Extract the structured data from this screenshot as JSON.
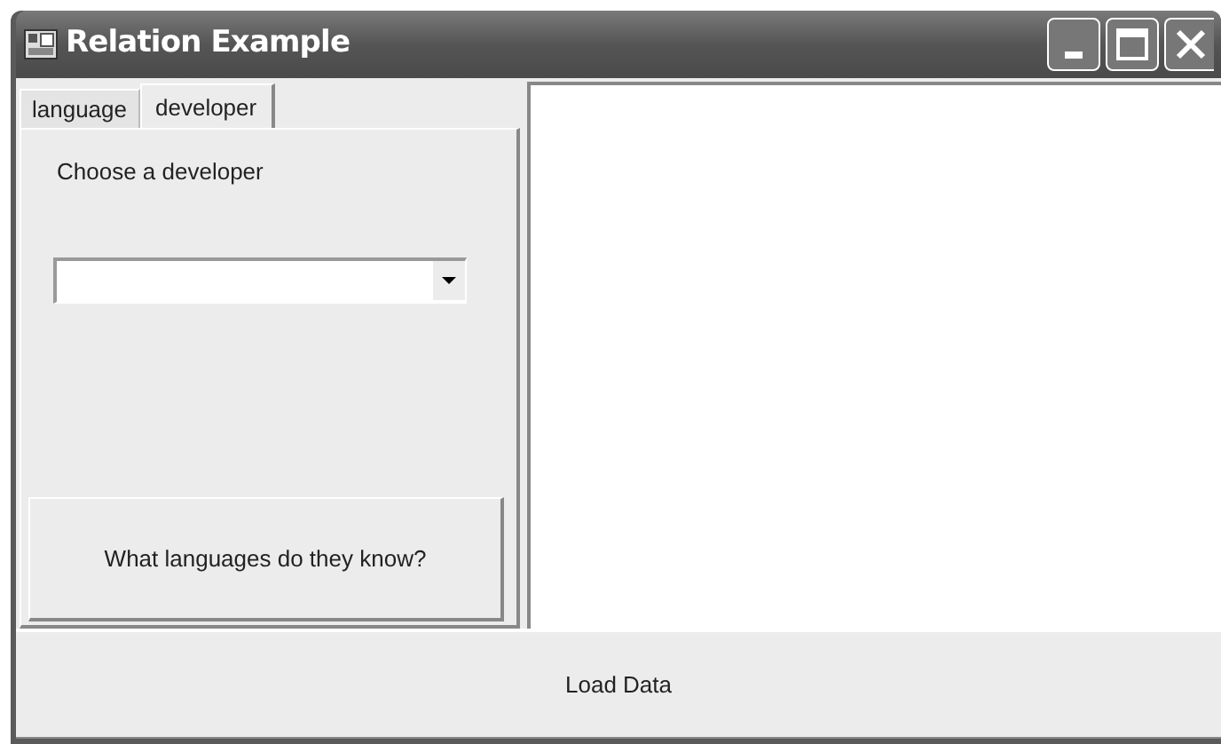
{
  "window": {
    "title": "Relation Example"
  },
  "tabs": [
    {
      "label": "language",
      "selected": false
    },
    {
      "label": "developer",
      "selected": true
    }
  ],
  "panel": {
    "label": "Choose a developer",
    "button": "What languages do they know?"
  },
  "load_button": "Load Data"
}
